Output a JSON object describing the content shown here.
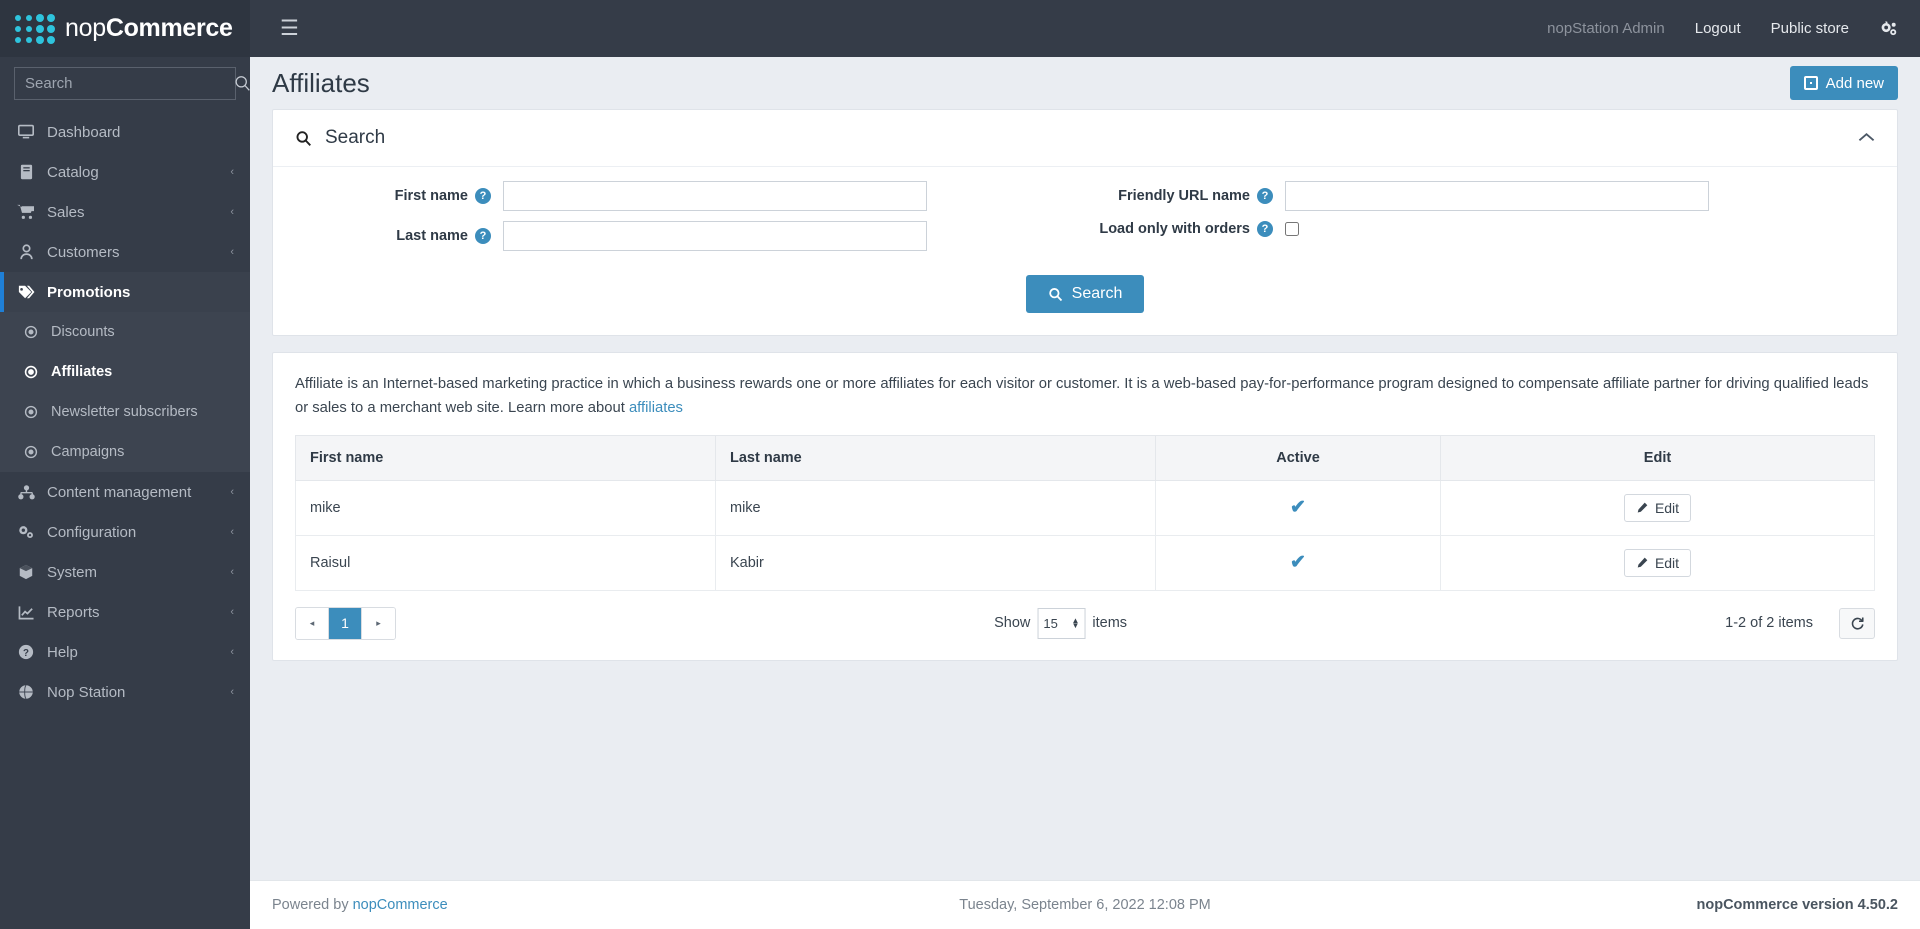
{
  "brand": {
    "name_light": "nop",
    "name_bold": "Commerce"
  },
  "sidebar": {
    "search_placeholder": "Search",
    "items": [
      {
        "label": "Dashboard",
        "icon": "monitor-icon",
        "caret": ""
      },
      {
        "label": "Catalog",
        "icon": "book-icon",
        "caret": "‹"
      },
      {
        "label": "Sales",
        "icon": "cart-icon",
        "caret": "‹"
      },
      {
        "label": "Customers",
        "icon": "user-icon",
        "caret": "‹"
      },
      {
        "label": "Promotions",
        "icon": "tag-icon",
        "caret": "ⱟ"
      },
      {
        "label": "Content management",
        "icon": "sitemap-icon",
        "caret": "‹"
      },
      {
        "label": "Configuration",
        "icon": "cogs-icon",
        "caret": "‹"
      },
      {
        "label": "System",
        "icon": "cube-icon",
        "caret": "‹"
      },
      {
        "label": "Reports",
        "icon": "chart-icon",
        "caret": "‹"
      },
      {
        "label": "Help",
        "icon": "question-circle-icon",
        "caret": "‹"
      },
      {
        "label": "Nop Station",
        "icon": "globe-icon",
        "caret": "‹"
      }
    ],
    "promotions_sub": [
      {
        "label": "Discounts",
        "icon": "dot-circle-icon"
      },
      {
        "label": "Affiliates",
        "icon": "dot-circle-icon"
      },
      {
        "label": "Newsletter subscribers",
        "icon": "dot-circle-icon"
      },
      {
        "label": "Campaigns",
        "icon": "dot-circle-icon"
      }
    ]
  },
  "topbar": {
    "user": "nopStation Admin",
    "logout": "Logout",
    "public_store": "Public store",
    "gear_icon": "cogs-icon",
    "menu_icon": "hamburger-icon"
  },
  "page": {
    "title": "Affiliates",
    "add_new": "Add new"
  },
  "search_panel": {
    "title": "Search",
    "first_name_label": "First name",
    "first_name_value": "",
    "last_name_label": "Last name",
    "last_name_value": "",
    "friendly_url_label": "Friendly URL name",
    "friendly_url_value": "",
    "load_only_with_orders_label": "Load only with orders",
    "load_only_with_orders_checked": false,
    "search_button": "Search",
    "help_glyph": "?",
    "collapse_icon": "chevron-up-icon"
  },
  "description": {
    "text": "Affiliate is an Internet-based marketing practice in which a business rewards one or more affiliates for each visitor or customer. It is a web-based pay-for-performance program designed to compensate affiliate partner for driving qualified leads or sales to a merchant web site. Learn more about ",
    "link_text": "affiliates"
  },
  "table": {
    "columns": [
      "First name",
      "Last name",
      "Active",
      "Edit"
    ],
    "rows": [
      {
        "first_name": "mike",
        "last_name": "mike",
        "active": true,
        "edit": "Edit"
      },
      {
        "first_name": "Raisul",
        "last_name": "Kabir",
        "active": true,
        "edit": "Edit"
      }
    ],
    "active_glyph": "✔"
  },
  "pagination": {
    "prev": "◂",
    "current_page": "1",
    "next": "▸",
    "show_label": "Show",
    "page_size": "15",
    "items_label": "items",
    "total_text": "1-2 of 2 items",
    "refresh_icon": "refresh-icon"
  },
  "footer": {
    "powered_by": "Powered by ",
    "powered_link": "nopCommerce",
    "date": "Tuesday, September 6, 2022 12:08 PM",
    "version": "nopCommerce version 4.50.2"
  },
  "colors": {
    "accent": "#3c8dbc",
    "sidebar_bg": "#353c48",
    "sidebar_sub_bg": "#3d4450",
    "page_bg": "#eaedf2",
    "logo_cyan": "#2ec4dd",
    "active_marker": "#1f7fd6"
  }
}
